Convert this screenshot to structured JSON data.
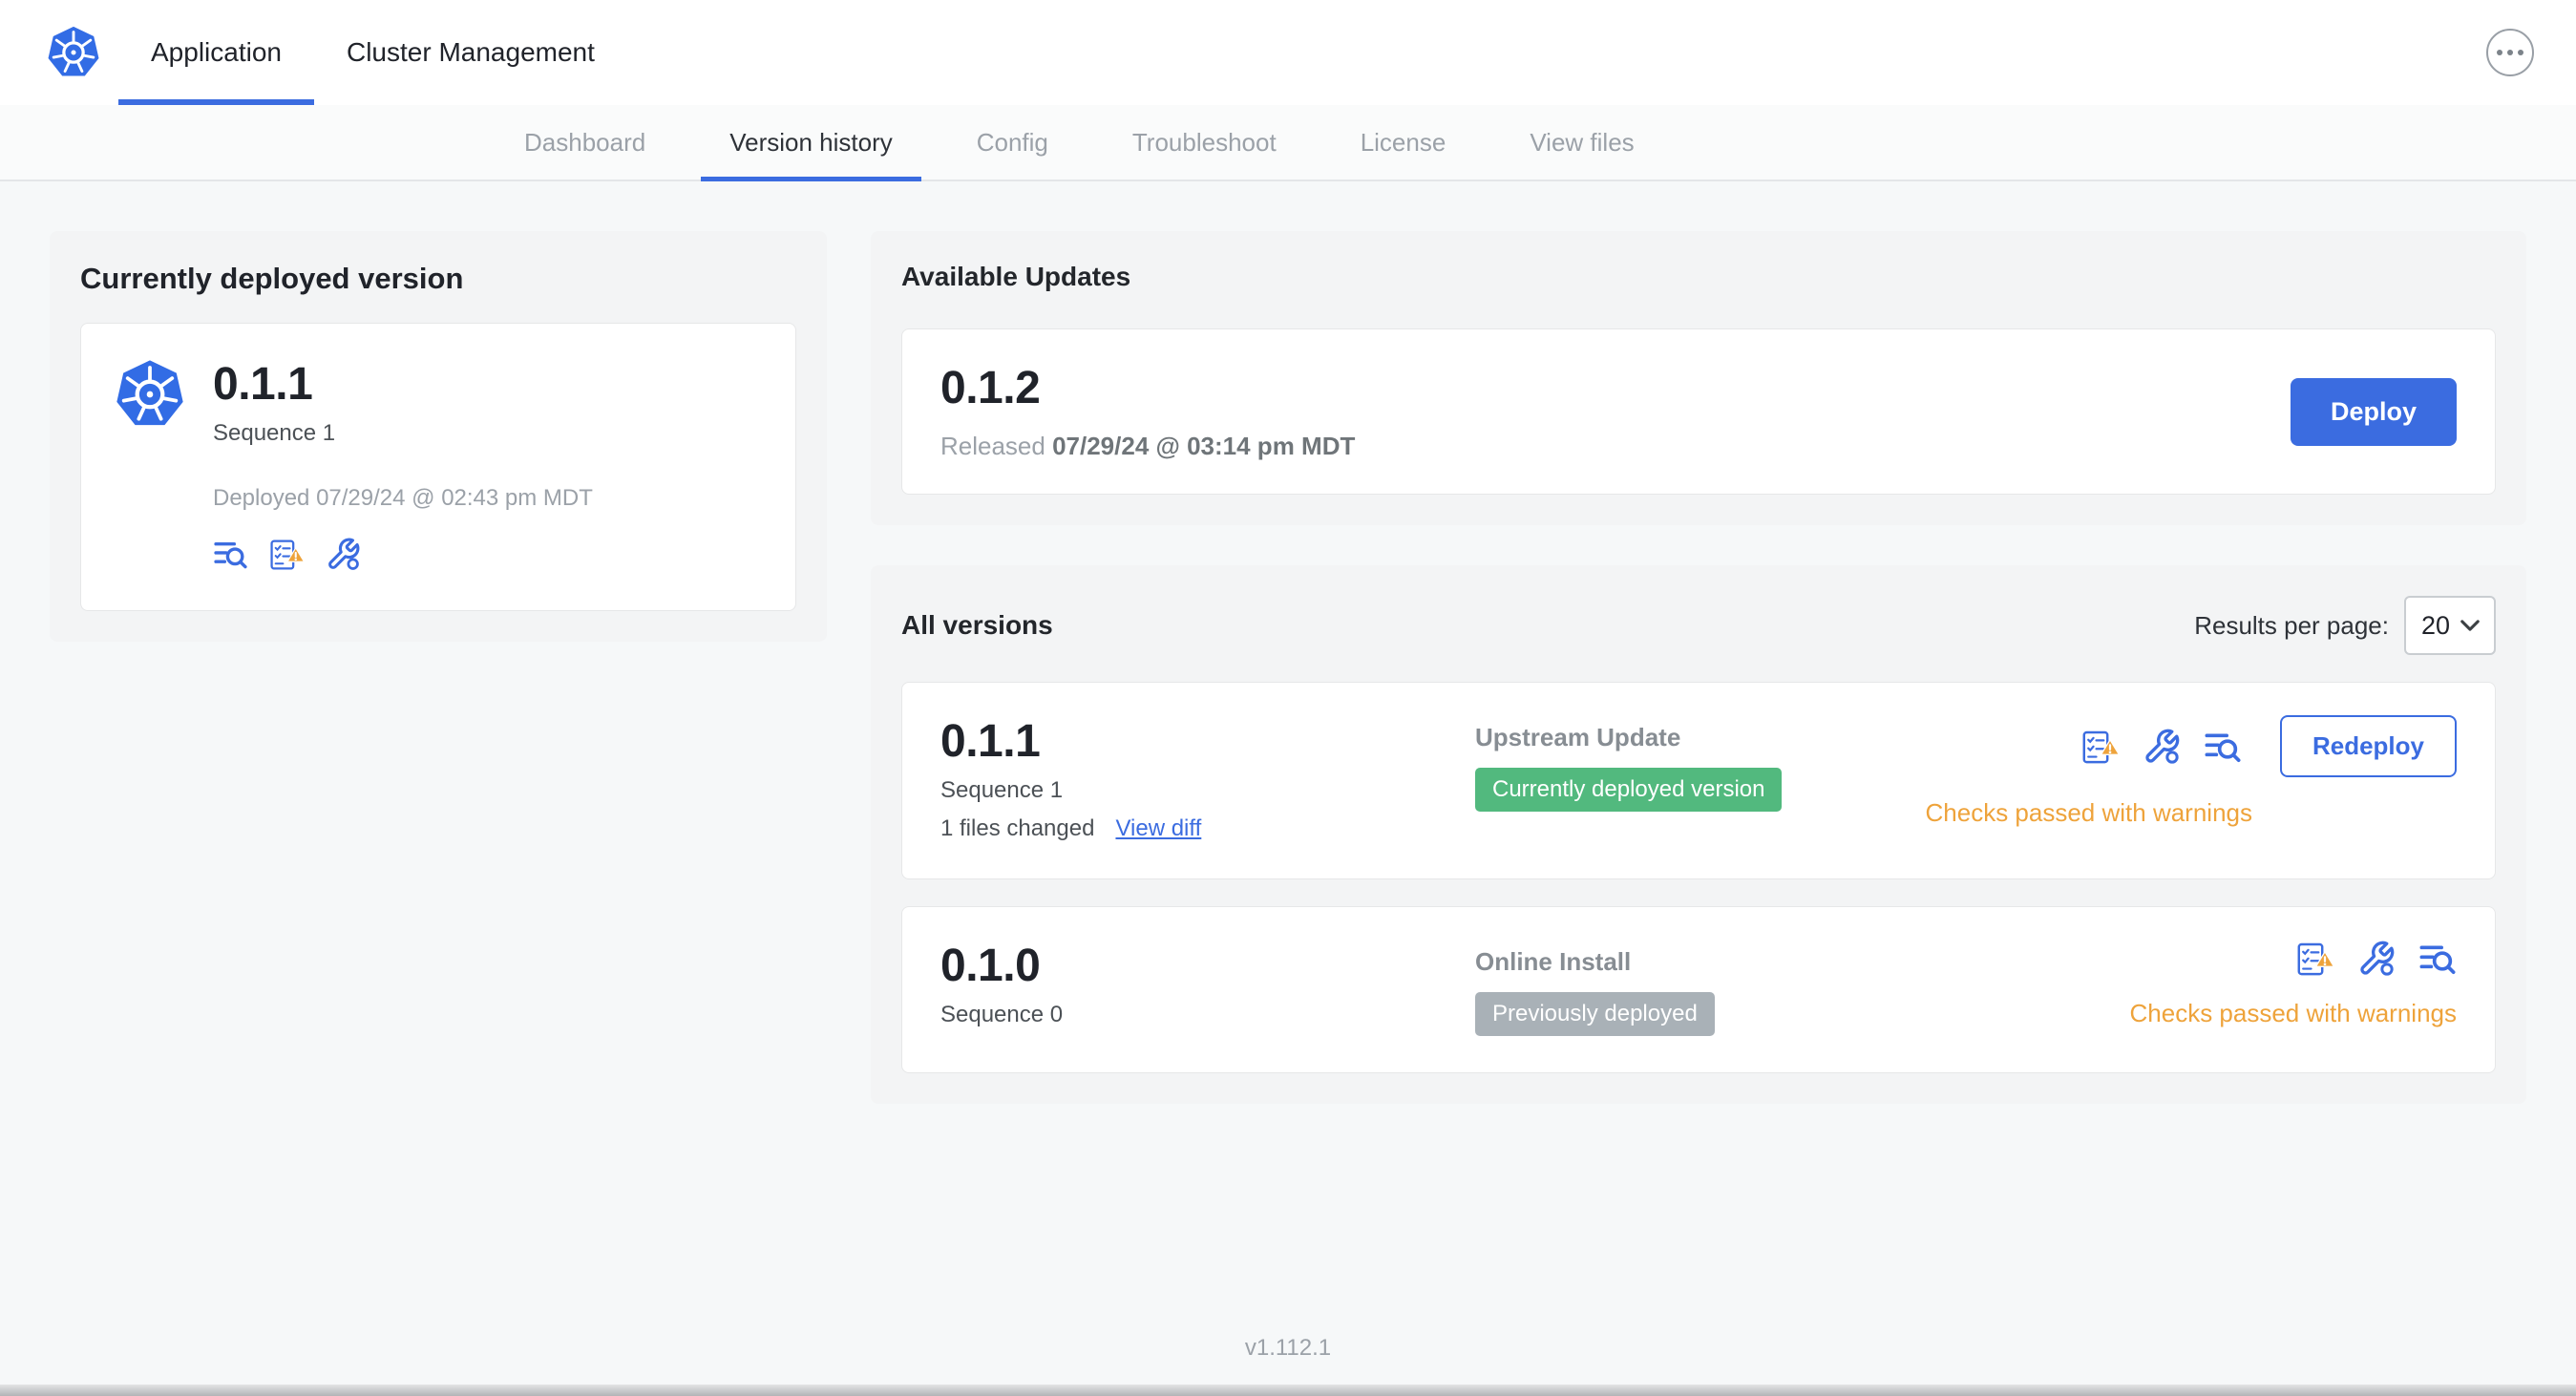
{
  "colors": {
    "accent": "#3b6ce0",
    "k8s_blue": "#326ce5",
    "green_badge": "#52b97e",
    "gray_badge": "#a9b1b7",
    "warning": "#eea33b"
  },
  "topbar": {
    "tabs": [
      {
        "label": "Application"
      },
      {
        "label": "Cluster Management"
      }
    ]
  },
  "subnav": {
    "tabs": [
      {
        "label": "Dashboard"
      },
      {
        "label": "Version history"
      },
      {
        "label": "Config"
      },
      {
        "label": "Troubleshoot"
      },
      {
        "label": "License"
      },
      {
        "label": "View files"
      }
    ],
    "active": "Version history"
  },
  "deployed_card": {
    "title": "Currently deployed version",
    "version": "0.1.1",
    "sequence": "Sequence 1",
    "deployed_at": "Deployed 07/29/24 @ 02:43 pm MDT"
  },
  "available_updates": {
    "title": "Available Updates",
    "version": "0.1.2",
    "released_prefix": "Released ",
    "released_at": "07/29/24 @ 03:14 pm MDT",
    "deploy_label": "Deploy"
  },
  "all_versions": {
    "title": "All versions",
    "results_label": "Results per page:",
    "results_value": "20",
    "rows": [
      {
        "version": "0.1.1",
        "sequence": "Sequence 1",
        "files_changed": "1 files changed",
        "view_diff_label": "View diff",
        "source": "Upstream Update",
        "badge": "Currently deployed version",
        "status": "Checks passed with warnings",
        "action": "Redeploy"
      },
      {
        "version": "0.1.0",
        "sequence": "Sequence 0",
        "source": "Online Install",
        "badge": "Previously deployed",
        "status": "Checks passed with warnings"
      }
    ]
  },
  "footer": {
    "version": "v1.112.1"
  }
}
